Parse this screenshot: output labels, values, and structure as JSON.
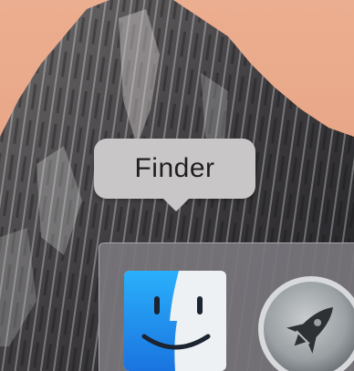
{
  "tooltip": {
    "label": "Finder"
  },
  "dock": {
    "items": [
      {
        "icon": "finder-icon"
      },
      {
        "icon": "launchpad-rocket-icon"
      }
    ]
  },
  "colors": {
    "wallpaper_sky": "#e7a98c",
    "tooltip_bg": "#c9c6c8",
    "dock_bg": "#78767c",
    "finder_blue": "#2a9bf0",
    "finder_light": "#eef1f4"
  }
}
